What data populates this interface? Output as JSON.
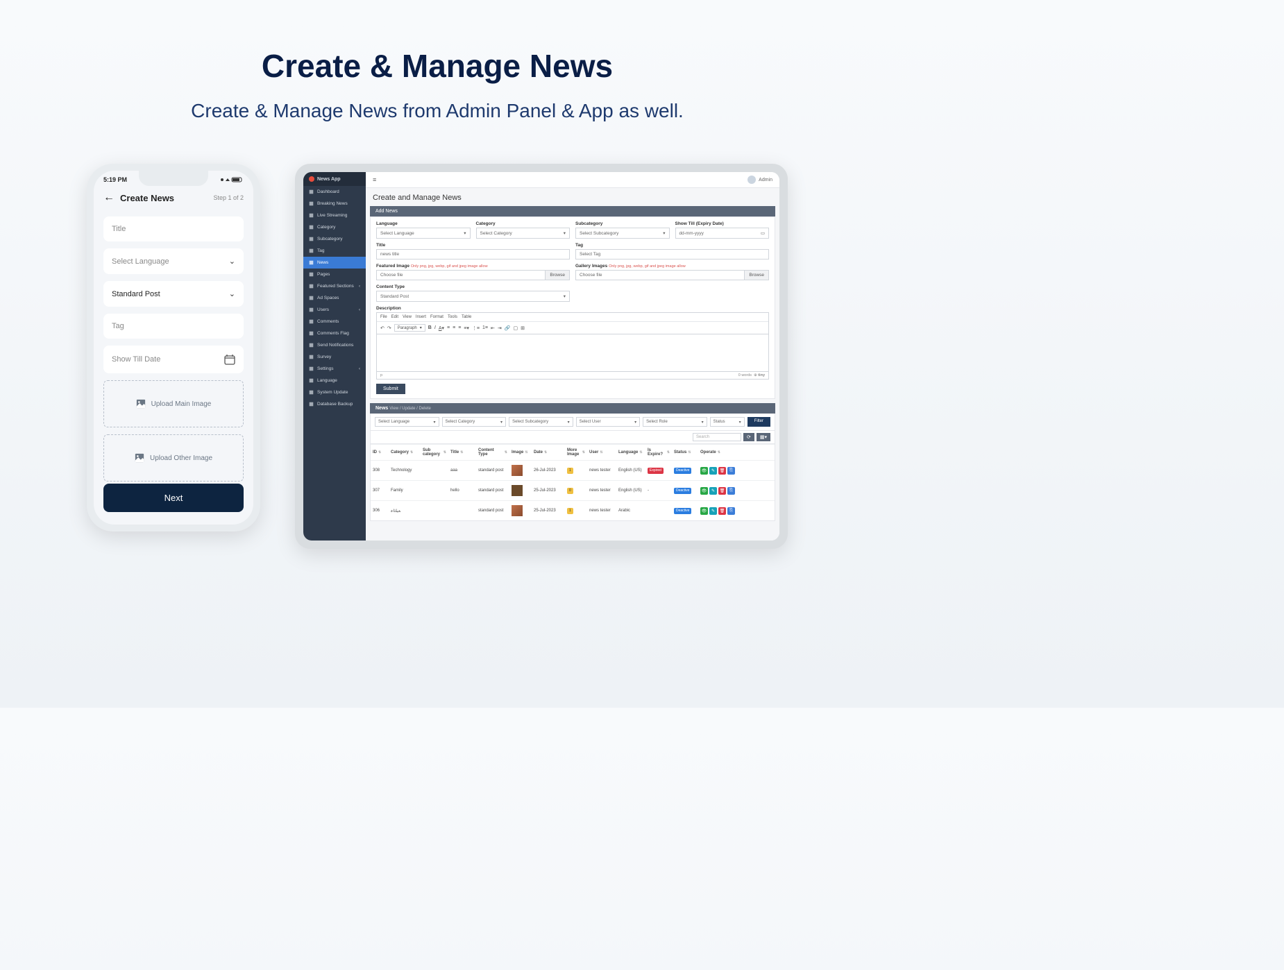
{
  "hero": {
    "title": "Create & Manage News",
    "subtitle": "Create & Manage News from Admin Panel & App as well."
  },
  "phone": {
    "time": "5:19 PM",
    "title": "Create News",
    "step": "Step 1 of 2",
    "fields": {
      "title_ph": "Title",
      "language_ph": "Select Language",
      "post_type": "Standard Post",
      "tag_ph": "Tag",
      "show_till_ph": "Show Till Date",
      "upload_main": "Upload Main Image",
      "upload_other": "Upload Other Image"
    },
    "next": "Next"
  },
  "tablet": {
    "brand": "News App",
    "user": "Admin",
    "sidebar": [
      {
        "icon": "dash",
        "label": "Dashboard"
      },
      {
        "icon": "bolt",
        "label": "Breaking News"
      },
      {
        "icon": "video",
        "label": "Live Streaming"
      },
      {
        "icon": "cat",
        "label": "Category"
      },
      {
        "icon": "sub",
        "label": "Subcategory"
      },
      {
        "icon": "tag",
        "label": "Tag"
      },
      {
        "icon": "news",
        "label": "News",
        "active": true
      },
      {
        "icon": "page",
        "label": "Pages"
      },
      {
        "icon": "feat",
        "label": "Featured Sections",
        "chev": true
      },
      {
        "icon": "ad",
        "label": "Ad Spaces"
      },
      {
        "icon": "user",
        "label": "Users",
        "chev": true
      },
      {
        "icon": "comm",
        "label": "Comments"
      },
      {
        "icon": "flag",
        "label": "Comments Flag"
      },
      {
        "icon": "bell",
        "label": "Send Notifications"
      },
      {
        "icon": "survey",
        "label": "Survey"
      },
      {
        "icon": "gear",
        "label": "Settings",
        "chev": true
      },
      {
        "icon": "lang",
        "label": "Language"
      },
      {
        "icon": "upd",
        "label": "System Update"
      },
      {
        "icon": "db",
        "label": "Database Backup"
      }
    ],
    "page_title": "Create and Manage News",
    "add_bar": "Add News",
    "form": {
      "language": {
        "label": "Language",
        "ph": "Select Language"
      },
      "category": {
        "label": "Category",
        "ph": "Select Category"
      },
      "subcategory": {
        "label": "Subcategory",
        "ph": "Select Subcategory"
      },
      "show_till": {
        "label": "Show Till (Expiry Date)",
        "ph": "dd-mm-yyyy"
      },
      "title": {
        "label": "Title",
        "ph": "news title"
      },
      "tag": {
        "label": "Tag",
        "ph": "Select Tag"
      },
      "featured": {
        "label": "Featured Image",
        "hint": "Only png, jpg, webp, gif and jpeg image allow",
        "ph": "Choose file",
        "btn": "Browse"
      },
      "gallery": {
        "label": "Gallery Images",
        "hint": "Only png, jpg, webp, gif and jpeg image allow",
        "ph": "Choose file",
        "btn": "Browse"
      },
      "content_type": {
        "label": "Content Type",
        "ph": "Standard Post"
      },
      "description": {
        "label": "Description"
      },
      "editor_menu": [
        "File",
        "Edit",
        "View",
        "Insert",
        "Format",
        "Tools",
        "Table"
      ],
      "editor_para": "Paragraph",
      "editor_foot_p": "p",
      "editor_foot_words": "0 words",
      "editor_brand": "tiny",
      "submit": "Submit"
    },
    "list_bar": {
      "title": "News",
      "sub": "View / Update / Delete"
    },
    "filters": {
      "language": "Select Language",
      "category": "Select Category",
      "subcategory": "Select Subcategory",
      "user": "Select User",
      "role": "Select Role",
      "status": "Status",
      "btn": "Filter",
      "search": "Search"
    },
    "table": {
      "headers": [
        "ID",
        "Category",
        "Sub category",
        "Title",
        "Content Type",
        "Image",
        "Date",
        "More Image",
        "User",
        "Language",
        "Is Expire?",
        "Status",
        "Operate"
      ],
      "rows": [
        {
          "id": "308",
          "cat": "Technology",
          "sub": "",
          "title": "aaa",
          "ct": "standard post",
          "date": "26-Jul-2023",
          "more": "1",
          "user": "news tester",
          "lang": "English (US)",
          "exp": "Expired",
          "stat": "Deactive"
        },
        {
          "id": "307",
          "cat": "Family",
          "sub": "",
          "title": "hello",
          "ct": "standard post",
          "date": "25-Jul-2023",
          "more": "0",
          "user": "news tester",
          "lang": "English (US)",
          "exp": "-",
          "stat": "Deactive"
        },
        {
          "id": "306",
          "cat": "ﺔﻴﻠﺋﺎﻋ",
          "sub": "",
          "title": "",
          "ct": "standard post",
          "date": "25-Jul-2023",
          "more": "1",
          "user": "news tester",
          "lang": "Arabic",
          "exp": "",
          "stat": "Deactive"
        }
      ]
    }
  }
}
